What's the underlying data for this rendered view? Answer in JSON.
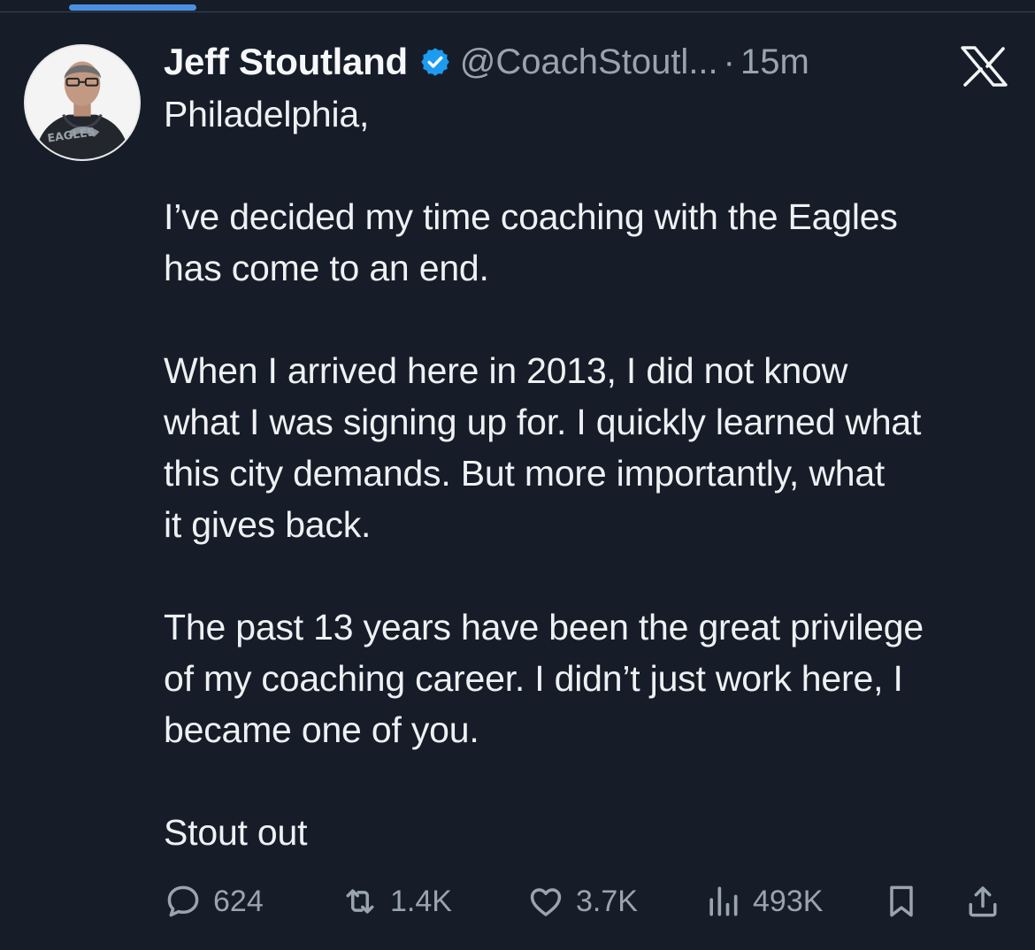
{
  "tweet": {
    "author_name": "Jeff Stoutland",
    "handle": "@CoachStoutl...",
    "separator": "·",
    "time": "15m",
    "paragraphs": [
      "Philadelphia,",
      "I’ve decided my time coaching with the Eagles\nhas come to an end.",
      "When I arrived here in 2013, I did not know\nwhat I was signing up for. I quickly learned what\nthis city demands. But more importantly, what\nit gives back.",
      "The past 13 years have been the great privilege\nof my coaching career. I didn’t just work here, I\nbecame one of you.",
      "Stout out"
    ],
    "avatar_text": "EAGLES"
  },
  "metrics": {
    "replies": "624",
    "reposts": "1.4K",
    "likes": "3.7K",
    "views": "493K"
  },
  "icons": {
    "verified": "verified-badge-icon",
    "platform": "x-logo-icon",
    "reply": "reply-icon",
    "repost": "repost-icon",
    "like": "heart-icon",
    "views": "views-chart-icon",
    "bookmark": "bookmark-icon",
    "share": "share-icon"
  },
  "colors": {
    "background": "#161d29",
    "text": "#eef1f3",
    "muted": "#9aa4ae",
    "verified": "#1d9bf0",
    "indicator": "#4a90e2"
  }
}
